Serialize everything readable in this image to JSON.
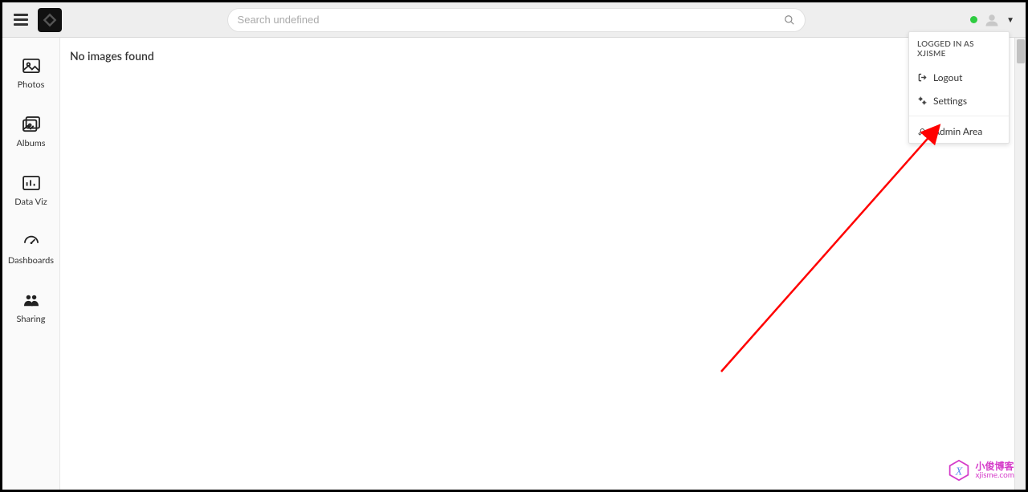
{
  "header": {
    "search_placeholder": "Search undefined"
  },
  "sidebar": {
    "items": [
      {
        "label": "Photos"
      },
      {
        "label": "Albums"
      },
      {
        "label": "Data Viz"
      },
      {
        "label": "Dashboards"
      },
      {
        "label": "Sharing"
      }
    ]
  },
  "content": {
    "empty_message": "No images found"
  },
  "user_menu": {
    "header": "LOGGED IN AS XJISME",
    "logout_label": "Logout",
    "settings_label": "Settings",
    "admin_label": "Admin Area"
  },
  "watermark": {
    "title": "小俊博客",
    "url": "xjisme.com"
  },
  "status_color": "#2ecc40"
}
